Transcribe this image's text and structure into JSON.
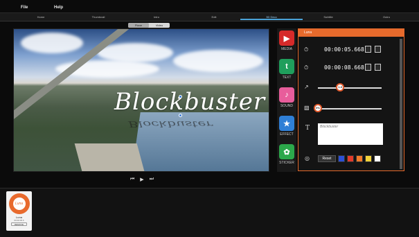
{
  "menu": {
    "file": "File",
    "help": "Help"
  },
  "tabs": [
    "Home",
    "Thumbnail",
    "Intro",
    "Edit",
    "3D Deco",
    "Subtitle",
    "Outro"
  ],
  "active_tab": "3D Deco",
  "view_toggle": {
    "plane": "Plane",
    "video": "Video",
    "selected": "Plane"
  },
  "video": {
    "overlay_text": "Blockbuster"
  },
  "playback": {
    "prev": "⏮",
    "play": "▶",
    "next": "⏭"
  },
  "sidebar": {
    "items": [
      {
        "label": "MEDIA",
        "icon": "play-icon",
        "color": "#d62a2a",
        "glyph": "▶"
      },
      {
        "label": "TEXT",
        "icon": "text-icon",
        "color": "#1f9e5c",
        "glyph": "t"
      },
      {
        "label": "SOUND",
        "icon": "sound-icon",
        "color": "#e85d9b",
        "glyph": "♪"
      },
      {
        "label": "EFFECT",
        "icon": "effect-icon",
        "color": "#2f7fd6",
        "glyph": "★"
      },
      {
        "label": "STICKER",
        "icon": "sticker-icon",
        "color": "#2ca84b",
        "glyph": "✿"
      }
    ]
  },
  "panel": {
    "title": "Luna",
    "start_time": "00:00:05.668",
    "end_time": "00:00:08.668",
    "scale_value": "1.0",
    "scale_fraction": 0.35,
    "opacity_value": "0%",
    "opacity_fraction": 0.0,
    "text_placeholder": "Blockbuster",
    "reset_label": "Reset",
    "swatches": [
      "#2b50d6",
      "#e23a2a",
      "#f07a2a",
      "#f2d23a",
      "#ffffff"
    ]
  },
  "timeline": {
    "clip": {
      "logo_text": "Luna",
      "name": "Luna",
      "duration": "00:00:05.6",
      "remove_label": "REMOVE"
    }
  },
  "colors": {
    "accent": "#e66a2c",
    "tab_active": "#9fd8ff"
  }
}
